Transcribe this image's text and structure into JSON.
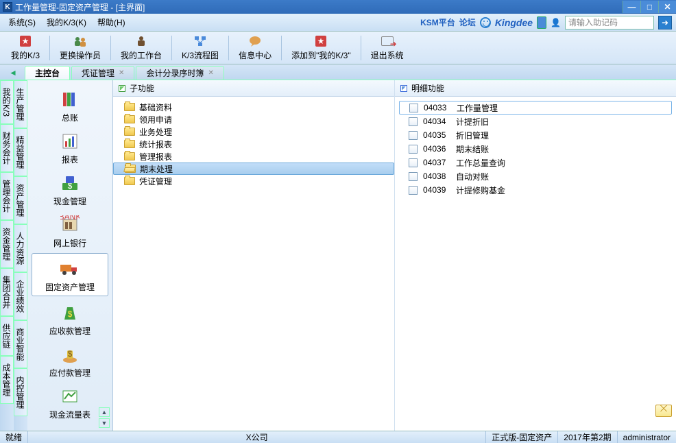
{
  "titlebar": {
    "title": "工作量管理-固定资产管理 - [主界面]"
  },
  "menu": {
    "items": [
      "系统(S)",
      "我的K/3(K)",
      "帮助(H)"
    ],
    "ksm": "KSM平台",
    "forum": "论坛",
    "kingdee": "Kingdee",
    "search_placeholder": "请输入助记码"
  },
  "toolbar": {
    "items": [
      {
        "label": "我的K/3",
        "icon": "star"
      },
      {
        "label": "更换操作员",
        "icon": "users"
      },
      {
        "label": "我的工作台",
        "icon": "desk"
      },
      {
        "label": "K/3流程图",
        "icon": "flow"
      },
      {
        "label": "信息中心",
        "icon": "bubble"
      },
      {
        "label": "添加到\"我的K/3\"",
        "icon": "add"
      },
      {
        "label": "退出系统",
        "icon": "exit"
      }
    ]
  },
  "doctabs": {
    "items": [
      {
        "label": "主控台",
        "active": true
      },
      {
        "label": "凭证管理",
        "closable": true
      },
      {
        "label": "会计分录序时簿",
        "closable": true
      }
    ]
  },
  "sidetabs_outer": [
    "我的K/3",
    "财务会计",
    "管理会计",
    "资金管理",
    "集团合并",
    "供应链",
    "成本管理"
  ],
  "sidetabs_inner": [
    "生产管理",
    "精益管理",
    "资产管理",
    "人力资源",
    "企业绩效",
    "商业智能",
    "内控管理"
  ],
  "modules": [
    {
      "label": "总账",
      "icon": "books"
    },
    {
      "label": "报表",
      "icon": "report"
    },
    {
      "label": "现金管理",
      "icon": "cash"
    },
    {
      "label": "网上银行",
      "icon": "bank"
    },
    {
      "label": "固定资产管理",
      "icon": "truck",
      "selected": true
    },
    {
      "label": "应收款管理",
      "icon": "moneybag"
    },
    {
      "label": "应付款管理",
      "icon": "moneyhand"
    },
    {
      "label": "现金流量表",
      "icon": "cashflow"
    }
  ],
  "sub_header": "子功能",
  "detail_header": "明细功能",
  "sub_items": [
    {
      "label": "基础资料"
    },
    {
      "label": "领用申请"
    },
    {
      "label": "业务处理"
    },
    {
      "label": "统计报表"
    },
    {
      "label": "管理报表"
    },
    {
      "label": "期末处理",
      "selected": true
    },
    {
      "label": "凭证管理"
    }
  ],
  "detail_items": [
    {
      "code": "04033",
      "label": "工作量管理",
      "selected": true
    },
    {
      "code": "04034",
      "label": "计提折旧"
    },
    {
      "code": "04035",
      "label": "折旧管理"
    },
    {
      "code": "04036",
      "label": "期末结账"
    },
    {
      "code": "04037",
      "label": "工作总量查询"
    },
    {
      "code": "04038",
      "label": "自动对账"
    },
    {
      "code": "04039",
      "label": "计提修购基金"
    }
  ],
  "status": {
    "ready": "就绪",
    "company": "X公司",
    "edition": "正式版-固定资产",
    "period": "2017年第2期",
    "user": "administrator"
  }
}
